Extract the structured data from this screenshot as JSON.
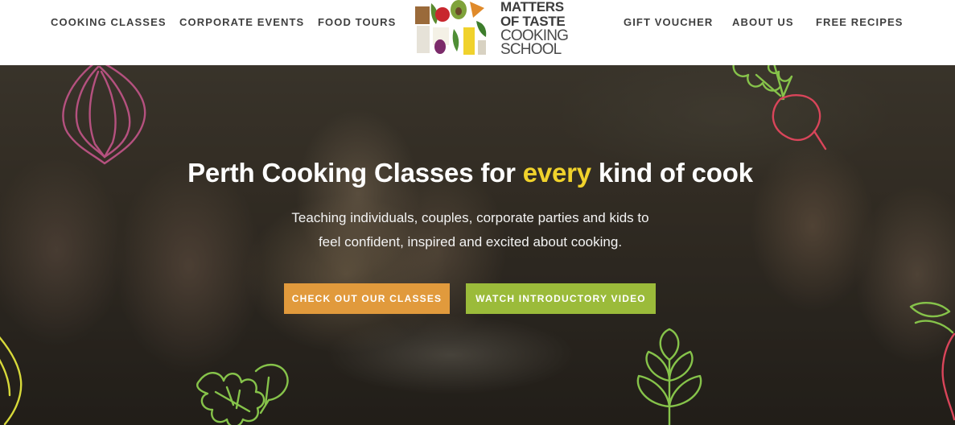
{
  "nav": {
    "left": [
      "COOKING CLASSES",
      "CORPORATE EVENTS",
      "FOOD TOURS"
    ],
    "right": [
      "GIFT VOUCHER",
      "ABOUT US",
      "FREE RECIPES"
    ]
  },
  "logo": {
    "line1": "MATTERS",
    "line2": "OF TASTE",
    "line3": "COOKING",
    "line4": "SCHOOL"
  },
  "hero": {
    "headline_before": "Perth Cooking Classes for ",
    "headline_accent": "every",
    "headline_after": " kind of cook",
    "sub_line1": "Teaching individuals, couples, corporate parties and kids to",
    "sub_line2": "feel confident, inspired and excited about cooking."
  },
  "buttons": {
    "classes": "CHECK OUT OUR CLASSES",
    "video": "WATCH INTRODUCTORY VIDEO"
  },
  "colors": {
    "accent_yellow": "#f0d22c",
    "button_orange": "#e19a3c",
    "button_green": "#9bbb3a",
    "onion_purple": "#b5517f",
    "leaf_green": "#86c34a",
    "radish_red": "#d9455a"
  },
  "icons": {
    "logo_mark": "vegetable-collage-icon",
    "onion": "onion-drawing-icon",
    "radish": "radish-drawing-icon",
    "leaf_left": "herb-leaf-icon",
    "leaf_right": "basil-leaf-icon"
  }
}
